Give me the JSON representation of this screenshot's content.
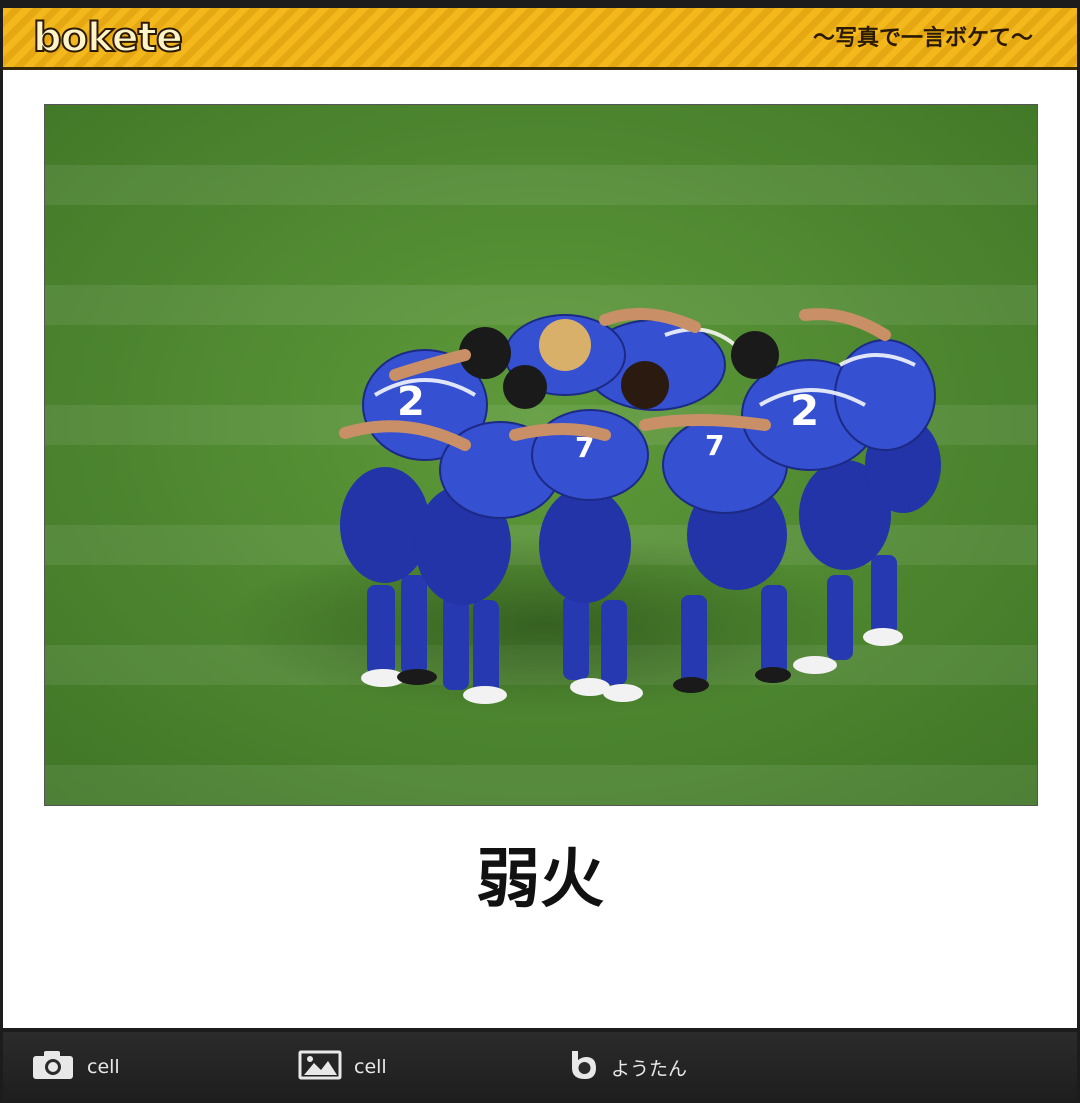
{
  "header": {
    "logo_text": "bokete",
    "tagline": "〜写真で一言ボケて〜"
  },
  "post": {
    "photo_icon": "soccer-team-huddle-photo",
    "caption": "弱火"
  },
  "footer": {
    "items": [
      {
        "icon": "camera-icon",
        "label": "cell"
      },
      {
        "icon": "image-icon",
        "label": "cell"
      },
      {
        "icon": "bokete-b-icon",
        "label": "ようたん"
      }
    ]
  },
  "colors": {
    "banner": "#f2b81c",
    "grass": "#4f8a2f",
    "jersey": "#2b3fb5",
    "footer": "#1e1e1e"
  }
}
